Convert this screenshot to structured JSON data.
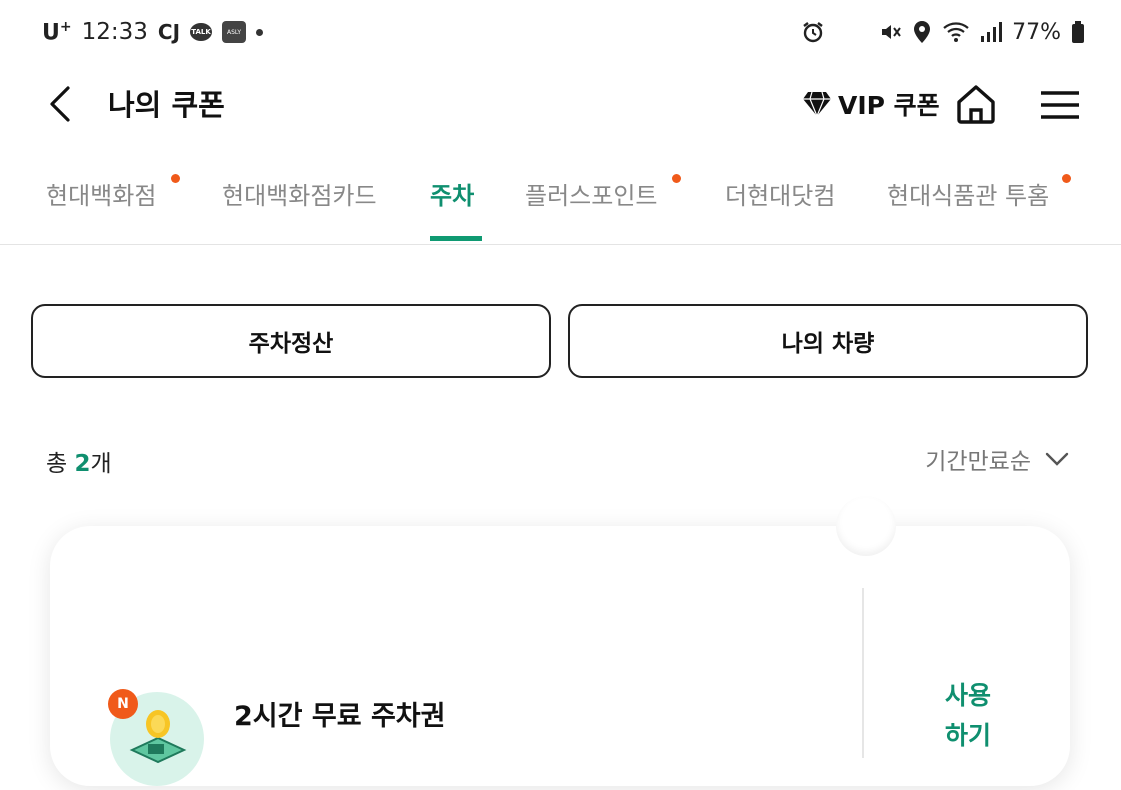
{
  "status_bar": {
    "carrier": "U",
    "time": "12:33",
    "app_talk": "TALK",
    "app_ably": "ASLY",
    "battery": "77%"
  },
  "header": {
    "title": "나의 쿠폰",
    "vip_label": "VIP 쿠폰"
  },
  "tabs": [
    {
      "label": "현대백화점",
      "has_dot": true
    },
    {
      "label": "현대백화점카드",
      "has_dot": false
    },
    {
      "label": "주차",
      "active": true
    },
    {
      "label": "플러스포인트",
      "has_dot": true
    },
    {
      "label": "더현대닷컴",
      "has_dot": false
    },
    {
      "label": "현대식품관 투홈",
      "has_dot": true
    }
  ],
  "actions": {
    "parking_pay": "주차정산",
    "my_vehicle": "나의 차량"
  },
  "list": {
    "count_prefix": "총 ",
    "count": "2",
    "count_suffix": "개",
    "sort_label": "기간만료순"
  },
  "coupon": {
    "badge": "N",
    "title": "2시간 무료 주차권",
    "use_line1": "사용",
    "use_line2": "하기"
  },
  "colors": {
    "accent": "#0f8f6f",
    "notification_dot": "#f05a1a"
  }
}
